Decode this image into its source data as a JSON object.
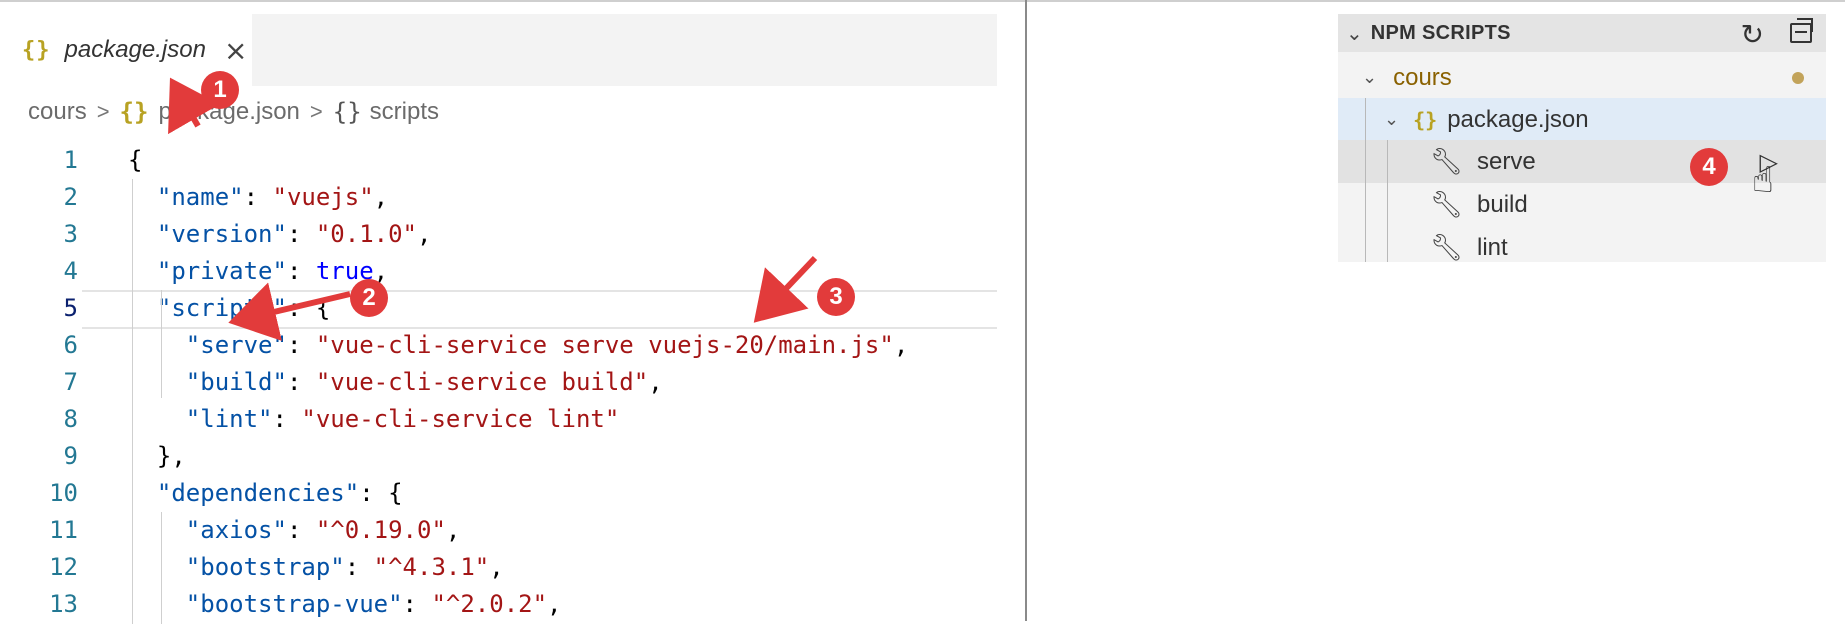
{
  "editor": {
    "tab": {
      "icon": "json-braces-icon",
      "braces": "{}",
      "filename": "package.json",
      "close": "×"
    },
    "breadcrumb": {
      "folder": "cours",
      "file_braces": "{}",
      "file": "package.json",
      "object_braces": "{}",
      "symbol": "scripts",
      "sep": ">"
    },
    "lines": [
      {
        "n": "1"
      },
      {
        "n": "2"
      },
      {
        "n": "3"
      },
      {
        "n": "4"
      },
      {
        "n": "5"
      },
      {
        "n": "6"
      },
      {
        "n": "7"
      },
      {
        "n": "8"
      },
      {
        "n": "9"
      },
      {
        "n": "10"
      },
      {
        "n": "11"
      },
      {
        "n": "12"
      },
      {
        "n": "13"
      }
    ],
    "code": {
      "open": "{",
      "name_key": "\"name\"",
      "name_val": "\"vuejs\"",
      "version_key": "\"version\"",
      "version_val": "\"0.1.0\"",
      "private_key": "\"private\"",
      "private_val": "true",
      "scripts_key": "\"scripts\"",
      "serve_key": "\"serve\"",
      "serve_val": "\"vue-cli-service serve vuejs-20/main.js\"",
      "build_key": "\"build\"",
      "build_val": "\"vue-cli-service build\"",
      "lint_key": "\"lint\"",
      "lint_val": "\"vue-cli-service lint\"",
      "close_scripts": "},",
      "deps_key": "\"dependencies\"",
      "axios_key": "\"axios\"",
      "axios_val": "\"^0.19.0\"",
      "bootstrap_key": "\"bootstrap\"",
      "bootstrap_val": "\"^4.3.1\"",
      "bsvue_key": "\"bootstrap-vue\"",
      "bsvue_val": "\"^2.0.2\""
    }
  },
  "npm_panel": {
    "title": "NPM SCRIPTS",
    "icons": {
      "refresh": "refresh-icon",
      "collapse": "collapse-all-icon"
    },
    "folder": "cours",
    "package": "package.json",
    "package_braces": "{}",
    "scripts": [
      "serve",
      "build",
      "lint"
    ]
  },
  "annotations": {
    "b1": "1",
    "b2": "2",
    "b3": "3",
    "b4": "4",
    "accent": "#e23b3b"
  }
}
